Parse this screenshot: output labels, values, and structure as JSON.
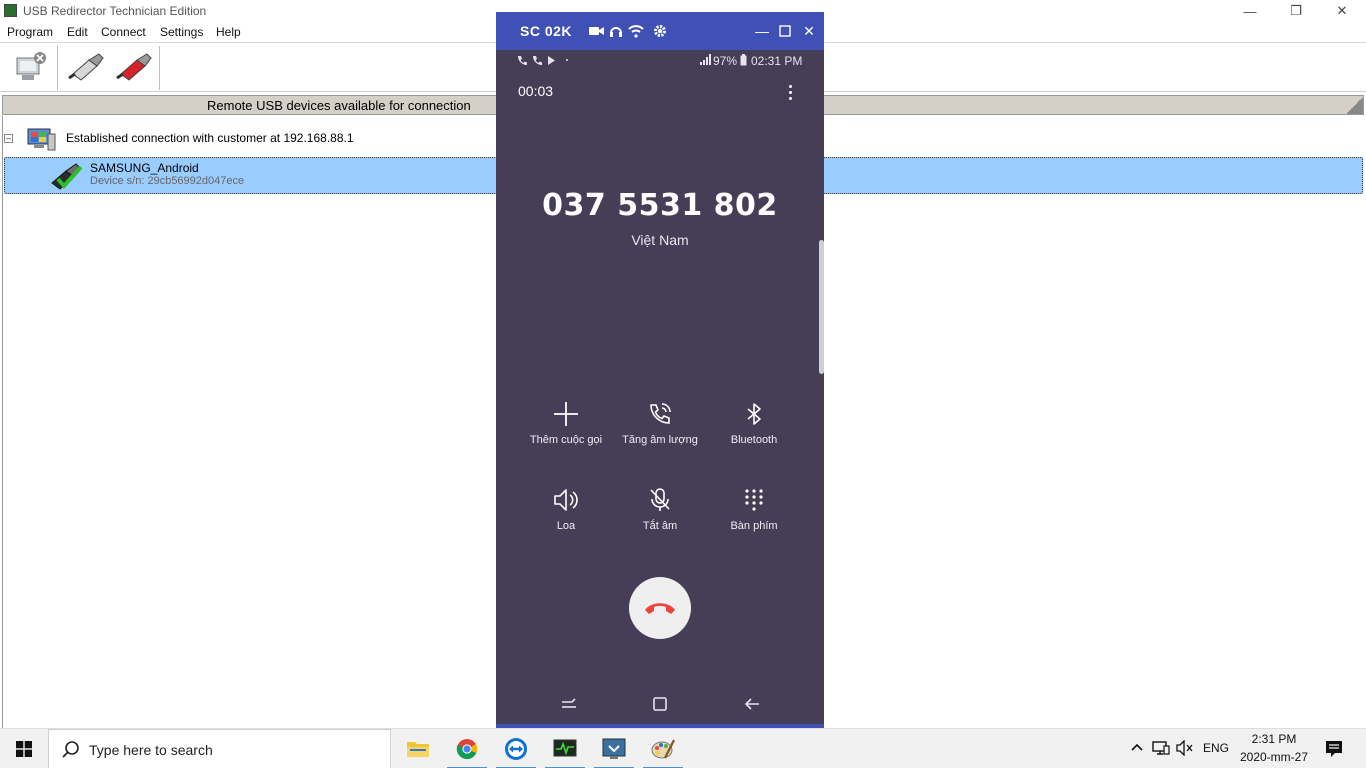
{
  "usb_app": {
    "title": "USB Redirector Technician Edition",
    "menu": [
      "Program",
      "Edit",
      "Connect",
      "Settings",
      "Help"
    ],
    "header": "Remote USB devices available for connection",
    "connection": "Established connection with customer at 192.168.88.1",
    "device": {
      "name": "SAMSUNG_Android",
      "serial": "Device s/n: 29cb56992d047ece"
    }
  },
  "phone_window": {
    "title": "SC 02K",
    "status_time": "02:31 PM",
    "battery": "97%",
    "call_timer": "00:03",
    "number": "037 5531 802",
    "country": "Việt Nam",
    "actions": [
      {
        "label": "Thêm cuộc gọi",
        "icon": "plus-icon"
      },
      {
        "label": "Tăng âm lượng",
        "icon": "phone-volume-icon"
      },
      {
        "label": "Bluetooth",
        "icon": "bluetooth-icon"
      },
      {
        "label": "Loa",
        "icon": "speaker-icon"
      },
      {
        "label": "Tắt âm",
        "icon": "mute-mic-icon"
      },
      {
        "label": "Bàn phím",
        "icon": "keypad-icon"
      }
    ]
  },
  "taskbar": {
    "search_placeholder": "Type here to search",
    "language": "ENG",
    "time": "2:31 PM",
    "date": "2020-mm-27"
  },
  "colors": {
    "phone_bg": "#463d57",
    "phone_title": "#3f51b5",
    "selection": "#99ccff",
    "end_call": "#e8453c"
  }
}
